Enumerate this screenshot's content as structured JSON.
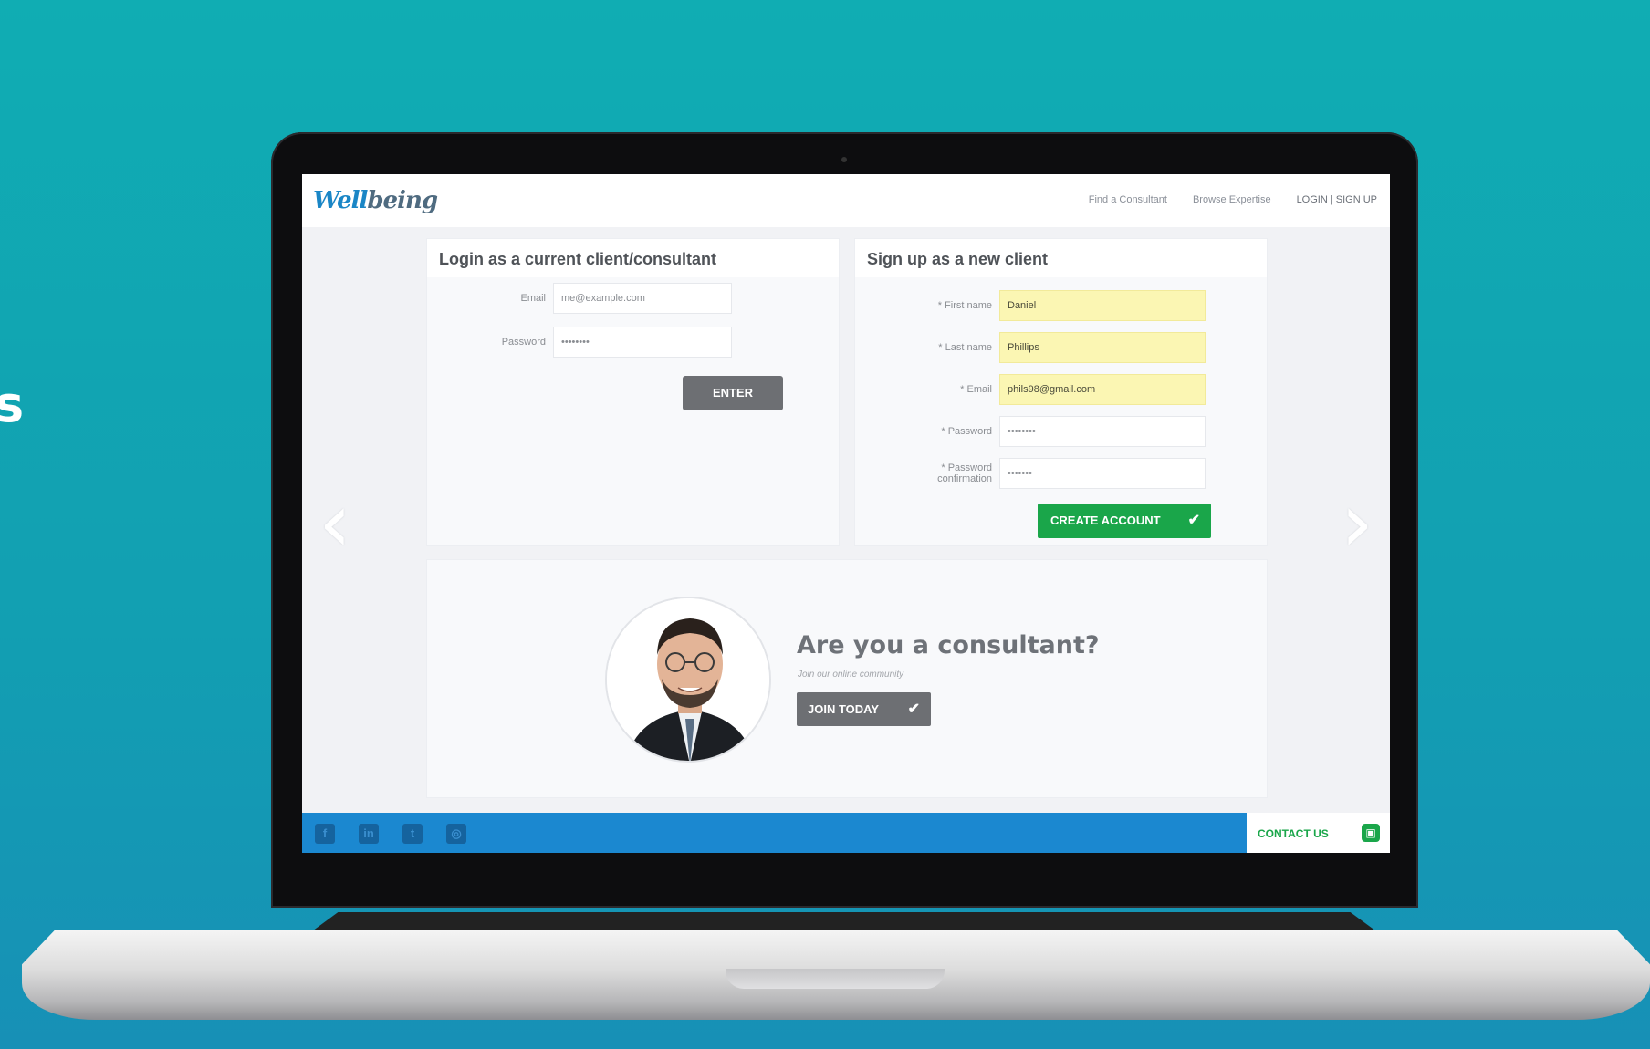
{
  "side_text": "s",
  "site": {
    "logo_part1": "Well",
    "logo_part2": "being",
    "nav": [
      "Find a Consultant",
      "Browse Expertise",
      "LOGIN | SIGN UP"
    ]
  },
  "login": {
    "title": "Login as a current client/consultant",
    "email_label": "Email",
    "email_value": "me@example.com",
    "password_label": "Password",
    "password_value": "••••••••",
    "enter_label": "ENTER"
  },
  "signup": {
    "title": "Sign up as a new client",
    "first_name_label": "* First name",
    "first_name_value": "Daniel",
    "last_name_label": "* Last name",
    "last_name_value": "Phillips",
    "email_label": "* Email",
    "email_value": "phils98@gmail.com",
    "password_label": "* Password",
    "password_value": "••••••••",
    "password_confirm_label": "* Password confirmation",
    "password_confirm_value": "•••••••",
    "create_label": "CREATE ACCOUNT",
    "create_icon": "check-icon"
  },
  "consultant": {
    "title": "Are you a consultant?",
    "subtitle": "Join our online community",
    "join_label": "JOIN TODAY",
    "join_icon": "check-icon"
  },
  "footer": {
    "social_icons": [
      "facebook-icon",
      "linkedin-icon",
      "twitter-icon",
      "instagram-icon"
    ],
    "contact_label": "CONTACT US"
  },
  "colors": {
    "background": "#10adb3",
    "brand_blue": "#1b88d0",
    "accent_green": "#1aa64a",
    "autofill_yellow": "#fbf6b3",
    "button_gray": "#6d6f73"
  }
}
